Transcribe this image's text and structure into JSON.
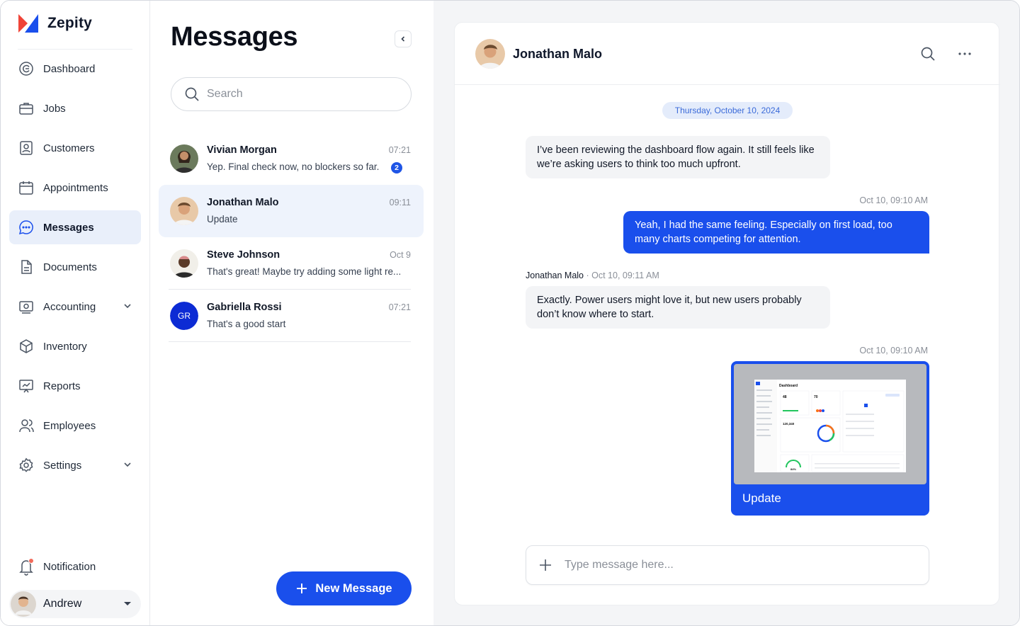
{
  "brand": {
    "name": "Zepity",
    "colors": {
      "red": "#f04438",
      "blue": "#1a4fec"
    }
  },
  "sidebar": {
    "items": [
      {
        "label": "Dashboard",
        "icon": "dashboard-icon"
      },
      {
        "label": "Jobs",
        "icon": "briefcase-icon"
      },
      {
        "label": "Customers",
        "icon": "customer-icon"
      },
      {
        "label": "Appointments",
        "icon": "calendar-icon"
      },
      {
        "label": "Messages",
        "icon": "chat-icon",
        "active": true
      },
      {
        "label": "Documents",
        "icon": "document-icon"
      },
      {
        "label": "Accounting",
        "icon": "accounting-icon",
        "expandable": true
      },
      {
        "label": "Inventory",
        "icon": "box-icon"
      },
      {
        "label": "Reports",
        "icon": "reports-icon"
      },
      {
        "label": "Employees",
        "icon": "users-icon"
      },
      {
        "label": "Settings",
        "icon": "gear-icon",
        "expandable": true
      }
    ],
    "notification_label": "Notification",
    "user_name": "Andrew"
  },
  "list": {
    "title": "Messages",
    "search_placeholder": "Search",
    "conversations": [
      {
        "name": "Vivian Morgan",
        "time": "07:21",
        "preview": "Yep. Final check now, no blockers so far.",
        "unread": "2"
      },
      {
        "name": "Jonathan Malo",
        "time": "09:11",
        "preview": "Update",
        "active": true
      },
      {
        "name": "Steve Johnson",
        "time": "Oct 9",
        "preview": "That's great! Maybe try adding some light re..."
      },
      {
        "name": "Gabriella Rossi",
        "time": "07:21",
        "preview": "That's a good start",
        "initials": "GR"
      }
    ],
    "new_message_label": "New Message"
  },
  "chat": {
    "contact_name": "Jonathan Malo",
    "date_divider": "Thursday, October 10, 2024",
    "messages": [
      {
        "direction": "in",
        "text": "I’ve been reviewing the dashboard flow again. It still feels like we’re asking users to think too much upfront."
      },
      {
        "direction": "out",
        "timestamp": "Oct 10, 09:10 AM",
        "text": "Yeah, I had the same feeling. Especially on first load, too many charts competing for attention."
      },
      {
        "direction": "in",
        "sender": "Jonathan Malo",
        "timestamp": "· Oct 10, 09:11 AM",
        "text": "Exactly. Power users might love it, but new users probably don’t know where to start."
      },
      {
        "direction": "out",
        "timestamp": "Oct 10, 09:10 AM",
        "caption": "Update",
        "attachment": {
          "title": "Dashboard",
          "stats": [
            "48",
            "70",
            "120,340",
            "84%"
          ]
        }
      }
    ],
    "composer_placeholder": "Type message here..."
  }
}
